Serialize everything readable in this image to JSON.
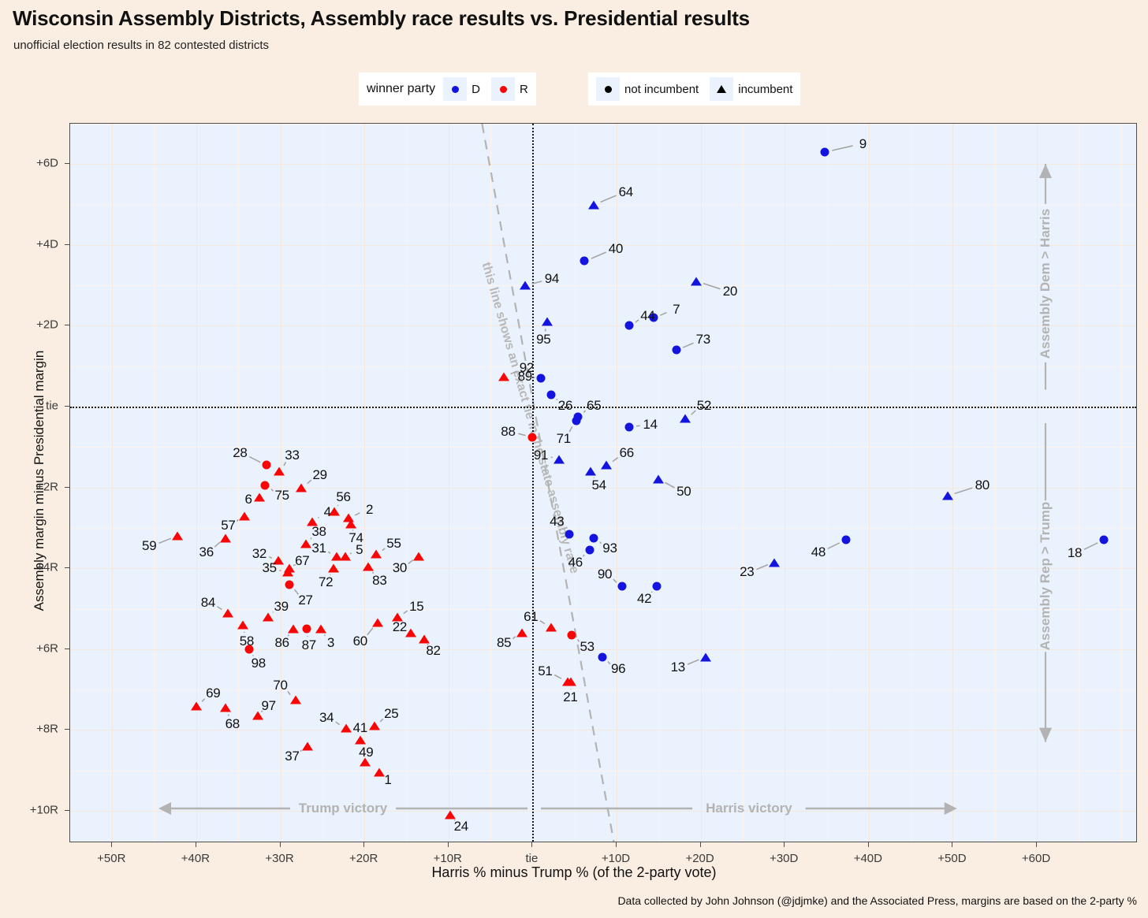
{
  "header": {
    "title": "Wisconsin Assembly Districts, Assembly race results vs. Presidential results",
    "subtitle": "unofficial election results in 82 contested districts"
  },
  "legend": {
    "party_title": "winner party",
    "party_items": [
      {
        "label": "D",
        "color": "#1414e0",
        "shape": "circle"
      },
      {
        "label": "R",
        "color": "#fa0505",
        "shape": "circle"
      }
    ],
    "incumbency_items": [
      {
        "label": "not incumbent",
        "shape": "circle",
        "color": "#000000"
      },
      {
        "label": "incumbent",
        "shape": "triangle",
        "color": "#000000"
      }
    ]
  },
  "annotations": {
    "tie_line": "this line shows an exact tie in the state assembly race",
    "trump_victory": "Trump victory",
    "harris_victory": "Harris victory",
    "assembly_dem": "Assembly Dem > Harris",
    "assembly_rep": "Assembly Rep > Trump"
  },
  "caption": "Data collected by John Johnson (@jdjmke) and the Associated Press, margins are based on the 2-party %",
  "chart_data": {
    "type": "scatter",
    "title": "Wisconsin Assembly Districts, Assembly race results vs. Presidential results",
    "subtitle": "unofficial election results in 82 contested districts",
    "xlabel": "Harris % minus Trump % (of the 2-party vote)",
    "ylabel": "Assembly margin minus Presidential margin",
    "xlim": [
      -55,
      72
    ],
    "ylim": [
      -10.8,
      7.0
    ],
    "grid": true,
    "xticks": [
      {
        "value": -50,
        "label": "+50R"
      },
      {
        "value": -40,
        "label": "+40R"
      },
      {
        "value": -30,
        "label": "+30R"
      },
      {
        "value": -20,
        "label": "+20R"
      },
      {
        "value": -10,
        "label": "+10R"
      },
      {
        "value": 0,
        "label": "tie"
      },
      {
        "value": 10,
        "label": "+10D"
      },
      {
        "value": 20,
        "label": "+20D"
      },
      {
        "value": 30,
        "label": "+30D"
      },
      {
        "value": 40,
        "label": "+40D"
      },
      {
        "value": 50,
        "label": "+50D"
      },
      {
        "value": 60,
        "label": "+60D"
      }
    ],
    "yticks": [
      {
        "value": 6,
        "label": "+6D"
      },
      {
        "value": 4,
        "label": "+4D"
      },
      {
        "value": 2,
        "label": "+2D"
      },
      {
        "value": 0,
        "label": "tie"
      },
      {
        "value": -2,
        "label": "+2R"
      },
      {
        "value": -4,
        "label": "+4R"
      },
      {
        "value": -6,
        "label": "+6R"
      },
      {
        "value": -8,
        "label": "+8R"
      },
      {
        "value": -10,
        "label": "+10R"
      }
    ],
    "legend_position": "top",
    "series": [
      {
        "name": "D winner",
        "color": "#1414e0"
      },
      {
        "name": "R winner",
        "color": "#fa0505"
      }
    ],
    "points": [
      {
        "label": "9",
        "x": 34.8,
        "y": 6.3,
        "party": "D",
        "incumbent": false,
        "lx": 39.3,
        "ly": 6.5
      },
      {
        "label": "64",
        "x": 7.3,
        "y": 5.0,
        "party": "D",
        "incumbent": true,
        "lx": 11.1,
        "ly": 5.3
      },
      {
        "label": "40",
        "x": 6.2,
        "y": 3.6,
        "party": "D",
        "incumbent": false,
        "lx": 9.9,
        "ly": 3.9
      },
      {
        "label": "20",
        "x": 19.5,
        "y": 3.1,
        "party": "D",
        "incumbent": true,
        "lx": 23.5,
        "ly": 2.85
      },
      {
        "label": "94",
        "x": -0.9,
        "y": 3.0,
        "party": "D",
        "incumbent": true,
        "lx": 2.3,
        "ly": 3.15
      },
      {
        "label": "7",
        "x": 14.4,
        "y": 2.2,
        "party": "D",
        "incumbent": false,
        "lx": 17.1,
        "ly": 2.4
      },
      {
        "label": "44",
        "x": 11.5,
        "y": 2.0,
        "party": "D",
        "incumbent": false,
        "lx": 13.7,
        "ly": 2.25
      },
      {
        "label": "95",
        "x": 1.7,
        "y": 2.1,
        "party": "D",
        "incumbent": true,
        "lx": 1.3,
        "ly": 1.65
      },
      {
        "label": "73",
        "x": 17.1,
        "y": 1.4,
        "party": "D",
        "incumbent": false,
        "lx": 20.3,
        "ly": 1.65
      },
      {
        "label": "92",
        "x": -3.4,
        "y": 0.75,
        "party": "R",
        "incumbent": true,
        "lx": -0.7,
        "ly": 0.95
      },
      {
        "label": "89",
        "x": 0.95,
        "y": 0.7,
        "party": "D",
        "incumbent": false,
        "lx": -0.9,
        "ly": 0.75
      },
      {
        "label": "26",
        "x": 2.2,
        "y": 0.3,
        "party": "D",
        "incumbent": false,
        "lx": 3.9,
        "ly": 0.03
      },
      {
        "label": "65",
        "x": 5.4,
        "y": -0.25,
        "party": "D",
        "incumbent": false,
        "lx": 7.3,
        "ly": 0.03
      },
      {
        "label": "52",
        "x": 18.2,
        "y": -0.3,
        "party": "D",
        "incumbent": true,
        "lx": 20.4,
        "ly": 0.03
      },
      {
        "label": "71",
        "x": 5.2,
        "y": -0.35,
        "party": "D",
        "incumbent": false,
        "lx": 3.7,
        "ly": -0.8
      },
      {
        "label": "14",
        "x": 11.5,
        "y": -0.5,
        "party": "D",
        "incumbent": false,
        "lx": 14.0,
        "ly": -0.45
      },
      {
        "label": "88",
        "x": 0.0,
        "y": -0.75,
        "party": "R",
        "incumbent": false,
        "lx": -2.9,
        "ly": -0.62
      },
      {
        "label": "91",
        "x": 3.2,
        "y": -1.3,
        "party": "D",
        "incumbent": true,
        "lx": 1.0,
        "ly": -1.2
      },
      {
        "label": "66",
        "x": 8.8,
        "y": -1.45,
        "party": "D",
        "incumbent": true,
        "lx": 11.2,
        "ly": -1.15
      },
      {
        "label": "54",
        "x": 6.9,
        "y": -1.6,
        "party": "D",
        "incumbent": true,
        "lx": 7.9,
        "ly": -1.95
      },
      {
        "label": "50",
        "x": 15.0,
        "y": -1.8,
        "party": "D",
        "incumbent": true,
        "lx": 18.0,
        "ly": -2.1
      },
      {
        "label": "80",
        "x": 49.4,
        "y": -2.2,
        "party": "D",
        "incumbent": true,
        "lx": 53.5,
        "ly": -1.95
      },
      {
        "label": "28",
        "x": -31.6,
        "y": -1.45,
        "party": "R",
        "incumbent": false,
        "lx": -34.8,
        "ly": -1.15
      },
      {
        "label": "33",
        "x": -30.1,
        "y": -1.6,
        "party": "R",
        "incumbent": true,
        "lx": -28.6,
        "ly": -1.2
      },
      {
        "label": "29",
        "x": -27.5,
        "y": -2.0,
        "party": "R",
        "incumbent": true,
        "lx": -25.3,
        "ly": -1.7
      },
      {
        "label": "75",
        "x": -31.8,
        "y": -1.95,
        "party": "R",
        "incumbent": false,
        "lx": -29.8,
        "ly": -2.2
      },
      {
        "label": "6",
        "x": -32.5,
        "y": -2.25,
        "party": "R",
        "incumbent": true,
        "lx": -33.8,
        "ly": -2.3
      },
      {
        "label": "56",
        "x": -23.6,
        "y": -2.6,
        "party": "R",
        "incumbent": true,
        "lx": -22.5,
        "ly": -2.25
      },
      {
        "label": "2",
        "x": -21.9,
        "y": -2.75,
        "party": "R",
        "incumbent": true,
        "lx": -19.4,
        "ly": -2.55
      },
      {
        "label": "57",
        "x": -34.3,
        "y": -2.7,
        "party": "R",
        "incumbent": true,
        "lx": -36.2,
        "ly": -2.95
      },
      {
        "label": "4",
        "x": -26.2,
        "y": -2.85,
        "party": "R",
        "incumbent": true,
        "lx": -24.4,
        "ly": -2.62
      },
      {
        "label": "74",
        "x": -21.6,
        "y": -2.9,
        "party": "R",
        "incumbent": true,
        "lx": -21.0,
        "ly": -3.25
      },
      {
        "label": "59",
        "x": -42.2,
        "y": -3.2,
        "party": "R",
        "incumbent": true,
        "lx": -45.6,
        "ly": -3.45
      },
      {
        "label": "36",
        "x": -36.5,
        "y": -3.25,
        "party": "R",
        "incumbent": true,
        "lx": -38.8,
        "ly": -3.6
      },
      {
        "label": "38",
        "x": -27.0,
        "y": -3.4,
        "party": "R",
        "incumbent": true,
        "lx": -25.4,
        "ly": -3.1
      },
      {
        "label": "31",
        "x": -23.3,
        "y": -3.7,
        "party": "R",
        "incumbent": true,
        "lx": -25.4,
        "ly": -3.5
      },
      {
        "label": "5",
        "x": -22.3,
        "y": -3.7,
        "party": "R",
        "incumbent": true,
        "lx": -20.6,
        "ly": -3.55
      },
      {
        "label": "55",
        "x": -18.6,
        "y": -3.65,
        "party": "R",
        "incumbent": true,
        "lx": -16.5,
        "ly": -3.4
      },
      {
        "label": "32",
        "x": -30.2,
        "y": -3.8,
        "party": "R",
        "incumbent": true,
        "lx": -32.5,
        "ly": -3.65
      },
      {
        "label": "67",
        "x": -28.9,
        "y": -4.0,
        "party": "R",
        "incumbent": true,
        "lx": -27.4,
        "ly": -3.82
      },
      {
        "label": "35",
        "x": -29.1,
        "y": -4.1,
        "party": "R",
        "incumbent": true,
        "lx": -31.3,
        "ly": -4.0
      },
      {
        "label": "72",
        "x": -23.7,
        "y": -4.0,
        "party": "R",
        "incumbent": true,
        "lx": -24.6,
        "ly": -4.35
      },
      {
        "label": "83",
        "x": -19.5,
        "y": -3.95,
        "party": "R",
        "incumbent": true,
        "lx": -18.2,
        "ly": -4.3
      },
      {
        "label": "30",
        "x": -13.5,
        "y": -3.7,
        "party": "R",
        "incumbent": true,
        "lx": -15.8,
        "ly": -4.0
      },
      {
        "label": "27",
        "x": -28.9,
        "y": -4.4,
        "party": "R",
        "incumbent": false,
        "lx": -27.0,
        "ly": -4.8
      },
      {
        "label": "90",
        "x": 10.7,
        "y": -4.45,
        "party": "D",
        "incumbent": false,
        "lx": 8.6,
        "ly": -4.15
      },
      {
        "label": "42",
        "x": 14.8,
        "y": -4.45,
        "party": "D",
        "incumbent": false,
        "lx": 13.3,
        "ly": -4.75
      },
      {
        "label": "43",
        "x": 4.4,
        "y": -3.15,
        "party": "D",
        "incumbent": false,
        "lx": 2.9,
        "ly": -2.85
      },
      {
        "label": "93",
        "x": 7.3,
        "y": -3.25,
        "party": "D",
        "incumbent": false,
        "lx": 9.2,
        "ly": -3.5
      },
      {
        "label": "46",
        "x": 6.8,
        "y": -3.55,
        "party": "D",
        "incumbent": false,
        "lx": 5.1,
        "ly": -3.85
      },
      {
        "label": "48",
        "x": 37.3,
        "y": -3.3,
        "party": "D",
        "incumbent": false,
        "lx": 34.0,
        "ly": -3.6
      },
      {
        "label": "18",
        "x": 68.0,
        "y": -3.3,
        "party": "D",
        "incumbent": false,
        "lx": 64.5,
        "ly": -3.62
      },
      {
        "label": "23",
        "x": 28.8,
        "y": -3.85,
        "party": "D",
        "incumbent": true,
        "lx": 25.5,
        "ly": -4.1
      },
      {
        "label": "84",
        "x": -36.2,
        "y": -5.1,
        "party": "R",
        "incumbent": true,
        "lx": -38.6,
        "ly": -4.85
      },
      {
        "label": "39",
        "x": -31.5,
        "y": -5.2,
        "party": "R",
        "incumbent": true,
        "lx": -29.9,
        "ly": -4.95
      },
      {
        "label": "58",
        "x": -34.5,
        "y": -5.4,
        "party": "R",
        "incumbent": true,
        "lx": -34.0,
        "ly": -5.8
      },
      {
        "label": "86",
        "x": -28.5,
        "y": -5.5,
        "party": "R",
        "incumbent": true,
        "lx": -29.8,
        "ly": -5.85
      },
      {
        "label": "87",
        "x": -26.9,
        "y": -5.5,
        "party": "R",
        "incumbent": false,
        "lx": -26.6,
        "ly": -5.9
      },
      {
        "label": "3",
        "x": -25.2,
        "y": -5.5,
        "party": "R",
        "incumbent": true,
        "lx": -24.0,
        "ly": -5.85
      },
      {
        "label": "60",
        "x": -18.4,
        "y": -5.35,
        "party": "R",
        "incumbent": true,
        "lx": -20.5,
        "ly": -5.8
      },
      {
        "label": "15",
        "x": -16.1,
        "y": -5.2,
        "party": "R",
        "incumbent": true,
        "lx": -13.8,
        "ly": -4.95
      },
      {
        "label": "22",
        "x": -14.5,
        "y": -5.6,
        "party": "R",
        "incumbent": true,
        "lx": -15.8,
        "ly": -5.45
      },
      {
        "label": "82",
        "x": -12.9,
        "y": -5.75,
        "party": "R",
        "incumbent": true,
        "lx": -11.8,
        "ly": -6.05
      },
      {
        "label": "85",
        "x": -1.3,
        "y": -5.6,
        "party": "R",
        "incumbent": true,
        "lx": -3.4,
        "ly": -5.85
      },
      {
        "label": "61",
        "x": 2.2,
        "y": -5.45,
        "party": "R",
        "incumbent": true,
        "lx": -0.2,
        "ly": -5.2
      },
      {
        "label": "53",
        "x": 4.7,
        "y": -5.65,
        "party": "R",
        "incumbent": false,
        "lx": 6.5,
        "ly": -5.95
      },
      {
        "label": "96",
        "x": 8.3,
        "y": -6.2,
        "party": "D",
        "incumbent": false,
        "lx": 10.2,
        "ly": -6.5
      },
      {
        "label": "13",
        "x": 20.6,
        "y": -6.2,
        "party": "D",
        "incumbent": true,
        "lx": 17.3,
        "ly": -6.45
      },
      {
        "label": "98",
        "x": -33.7,
        "y": -6.0,
        "party": "R",
        "incumbent": false,
        "lx": -32.6,
        "ly": -6.35
      },
      {
        "label": "51",
        "x": 4.2,
        "y": -6.8,
        "party": "R",
        "incumbent": true,
        "lx": 1.5,
        "ly": -6.55
      },
      {
        "label": "21",
        "x": 4.6,
        "y": -6.8,
        "party": "R",
        "incumbent": true,
        "lx": 4.5,
        "ly": -7.2
      },
      {
        "label": "69",
        "x": -40.0,
        "y": -7.4,
        "party": "R",
        "incumbent": true,
        "lx": -38.0,
        "ly": -7.1
      },
      {
        "label": "68",
        "x": -36.5,
        "y": -7.45,
        "party": "R",
        "incumbent": true,
        "lx": -35.7,
        "ly": -7.85
      },
      {
        "label": "97",
        "x": -32.7,
        "y": -7.65,
        "party": "R",
        "incumbent": true,
        "lx": -31.4,
        "ly": -7.4
      },
      {
        "label": "70",
        "x": -28.2,
        "y": -7.25,
        "party": "R",
        "incumbent": true,
        "lx": -30.0,
        "ly": -6.9
      },
      {
        "label": "34",
        "x": -22.2,
        "y": -7.95,
        "party": "R",
        "incumbent": true,
        "lx": -24.5,
        "ly": -7.7
      },
      {
        "label": "41",
        "x": -20.5,
        "y": -8.25,
        "party": "R",
        "incumbent": true,
        "lx": -20.5,
        "ly": -7.95
      },
      {
        "label": "25",
        "x": -18.8,
        "y": -7.9,
        "party": "R",
        "incumbent": true,
        "lx": -16.8,
        "ly": -7.6
      },
      {
        "label": "37",
        "x": -26.8,
        "y": -8.4,
        "party": "R",
        "incumbent": true,
        "lx": -28.6,
        "ly": -8.65
      },
      {
        "label": "49",
        "x": -19.9,
        "y": -8.8,
        "party": "R",
        "incumbent": true,
        "lx": -19.8,
        "ly": -8.55
      },
      {
        "label": "1",
        "x": -18.2,
        "y": -9.05,
        "party": "R",
        "incumbent": true,
        "lx": -17.2,
        "ly": -9.25
      },
      {
        "label": "24",
        "x": -9.8,
        "y": -10.1,
        "party": "R",
        "incumbent": true,
        "lx": -8.5,
        "ly": -10.4
      }
    ]
  }
}
